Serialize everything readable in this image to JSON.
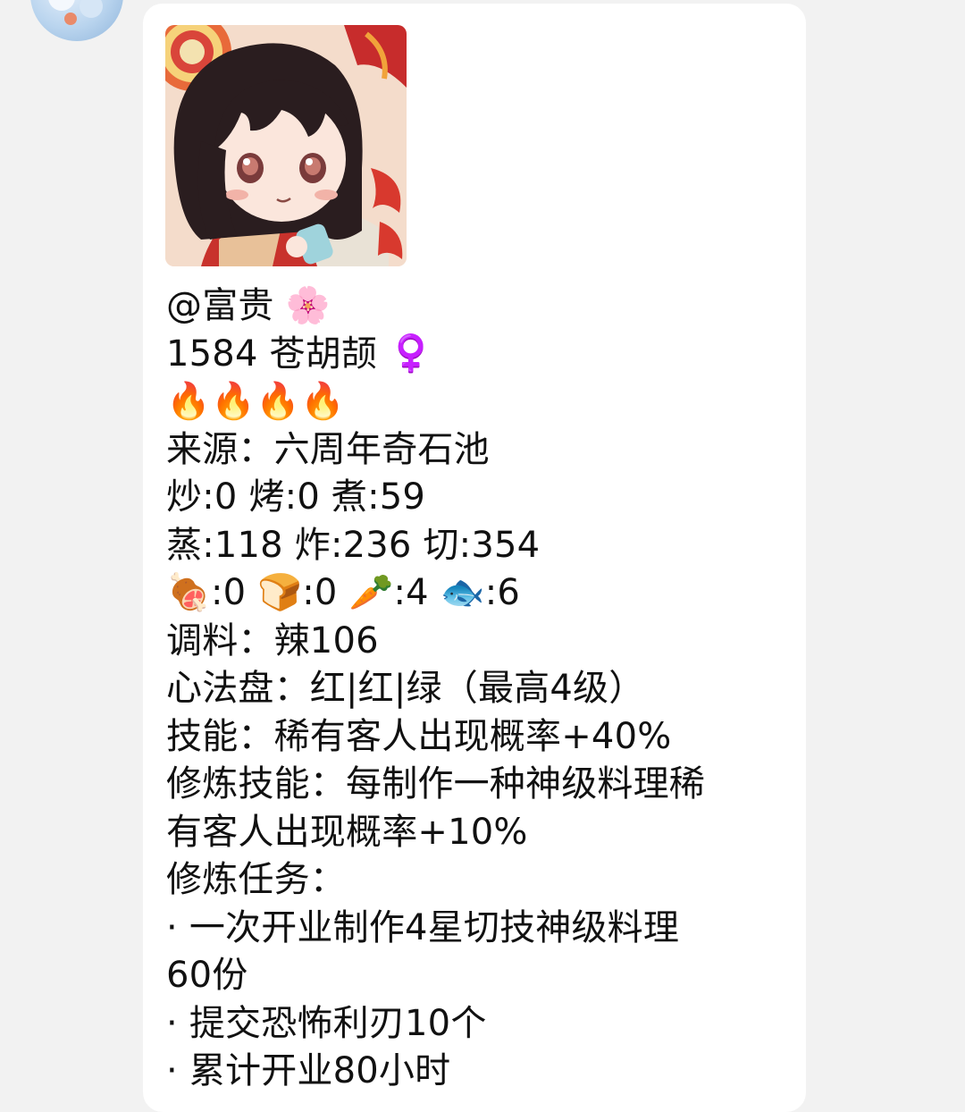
{
  "message": {
    "lines": [
      "@富贵 🌸",
      "1584 苍胡颉 ♀️",
      "🔥🔥🔥🔥",
      "来源：六周年奇石池",
      "炒:0 烤:0 煮:59",
      "蒸:118 炸:236 切:354",
      "🍖:0 🍞:0 🥕:4 🐟:6",
      "调料：辣106",
      "心法盘：红|红|绿（最高4级）",
      "技能：稀有客人出现概率+40%",
      "修炼技能：每制作一种神级料理稀",
      "有客人出现概率+10%",
      "修炼任务：",
      "· 一次开业制作4星切技神级料理",
      "60份",
      "· 提交恐怖利刃10个",
      "· 累计开业80小时"
    ]
  },
  "colors": {
    "background": "#f2f2f2",
    "bubble": "#ffffff",
    "text": "#111111"
  }
}
